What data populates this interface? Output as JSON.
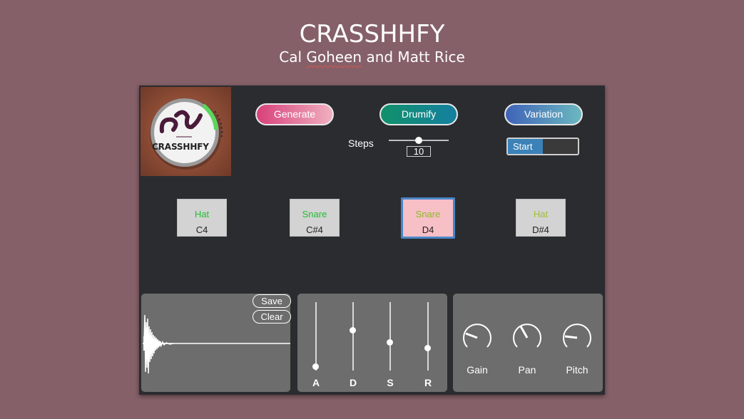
{
  "header": {
    "title": "CRASSHHFY",
    "subtitle_prefix": "Cal ",
    "subtitle_flagged": "Goheen",
    "subtitle_suffix": " and Matt Rice"
  },
  "logo": {
    "text": "CRASSHHFY"
  },
  "controls": {
    "generate_label": "Generate",
    "drumify_label": "Drumify",
    "variation_label": "Variation",
    "steps_label": "Steps",
    "steps_value": "10",
    "start_label": "Start"
  },
  "pads": [
    {
      "name": "Hat",
      "note": "C4",
      "name_color": "#1fbf2f",
      "active": false
    },
    {
      "name": "Snare",
      "note": "C#4",
      "name_color": "#1fbf2f",
      "active": false
    },
    {
      "name": "Snare",
      "note": "D4",
      "name_color": "#8db82a",
      "active": true
    },
    {
      "name": "Hat",
      "note": "D#4",
      "name_color": "#9fbf30",
      "active": false
    }
  ],
  "waveform": {
    "save_label": "Save",
    "clear_label": "Clear"
  },
  "envelope": {
    "labels": [
      "A",
      "D",
      "S",
      "R"
    ],
    "levels": [
      0.0,
      0.5,
      0.3,
      0.23
    ]
  },
  "knobs": {
    "labels": [
      "Gain",
      "Pan",
      "Pitch"
    ]
  },
  "colors": {
    "background": "#856068",
    "panel": "#2b2c30",
    "subpanel": "#6d6d6d",
    "toggle_on": "#3a82b8"
  }
}
